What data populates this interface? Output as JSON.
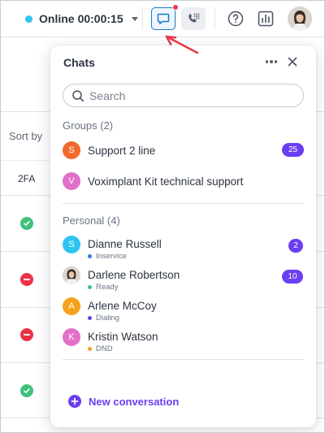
{
  "topbar": {
    "status_label": "Online",
    "status_timer": "00:00:15",
    "status_color": "#2ec4f1",
    "icons": [
      "chat-icon",
      "dialpad-icon",
      "help-icon",
      "stats-icon"
    ]
  },
  "background": {
    "sort_label": "Sort by",
    "col_header": "2FA",
    "row_states": [
      "enabled",
      "disabled",
      "disabled",
      "enabled"
    ]
  },
  "popup": {
    "title": "Chats",
    "search_placeholder": "Search",
    "groups_label": "Groups (2)",
    "groups": [
      {
        "initial": "S",
        "name": "Support 2 line",
        "badge": "25",
        "color": "#f26a2e"
      },
      {
        "initial": "V",
        "name": "Voximplant Kit technical support",
        "badge": "",
        "color": "#e370c8"
      }
    ],
    "personal_label": "Personal (4)",
    "personal": [
      {
        "initial": "S",
        "name": "Dianne Russell",
        "status": "Inservice",
        "status_color": "#2f7de1",
        "badge": "2",
        "color": "#2ec4f1"
      },
      {
        "initial": "",
        "name": "Darlene Robertson",
        "status": "Ready",
        "status_color": "#3fc17a",
        "badge": "10",
        "color": "#c9a38a"
      },
      {
        "initial": "A",
        "name": "Arlene McCoy",
        "status": "Dialing",
        "status_color": "#6b3ef1",
        "badge": "",
        "color": "#f6a11c"
      },
      {
        "initial": "K",
        "name": "Kristin Watson",
        "status": "DND",
        "status_color": "#f6a11c",
        "badge": "",
        "color": "#e370c8"
      }
    ],
    "new_conversation": "New conversation",
    "accent_color": "#6b3ef1"
  }
}
